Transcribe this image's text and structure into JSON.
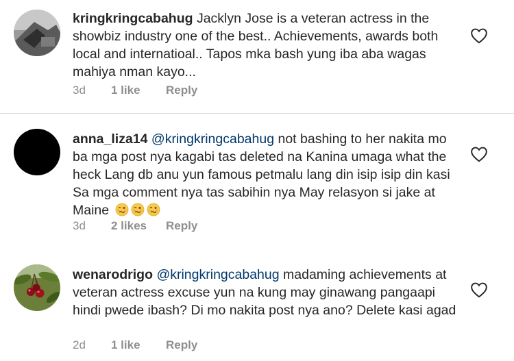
{
  "comments": [
    {
      "username": "kringkringcabahug",
      "mention": "",
      "text": "Jacklyn Jose is a veteran actress in the showbiz industry one of the best.. Achievements, awards both local and internatioal.. Tapos mka bash yung iba aba wagas mahiya nman kayo...",
      "time": "3d",
      "likes": "1 like",
      "reply": "Reply",
      "avatar": "photo-avatar-grey"
    },
    {
      "username": "anna_liza14",
      "mention": "@kringkringcabahug",
      "text": "not bashing to her nakita mo ba mga post nya kagabi tas deleted na Kanina umaga what the heck Lang db anu yun famous petmalu lang din isip isip din kasi Sa mga comment nya tas sabihin nya May relasyon si jake at Maine",
      "emojis": [
        "woozy-face-emoji",
        "woozy-face-emoji",
        "woozy-face-emoji"
      ],
      "time": "3d",
      "likes": "2 likes",
      "reply": "Reply",
      "avatar": "black-avatar"
    },
    {
      "username": "wenarodrigo",
      "mention": "@kringkringcabahug",
      "text": "madaming achievements at veteran actress excuse yun na kung may ginawang pangaapi hindi pwede ibash? Di mo nakita post nya ano? Delete kasi agad",
      "time": "2d",
      "likes": "1 like",
      "reply": "Reply",
      "avatar": "cherries-photo-avatar"
    }
  ],
  "colors": {
    "text": "#262626",
    "muted": "#8e8e8e",
    "mention": "#00376b",
    "divider": "#dbdbdb"
  },
  "icons": {
    "like": "heart-outline-icon"
  }
}
